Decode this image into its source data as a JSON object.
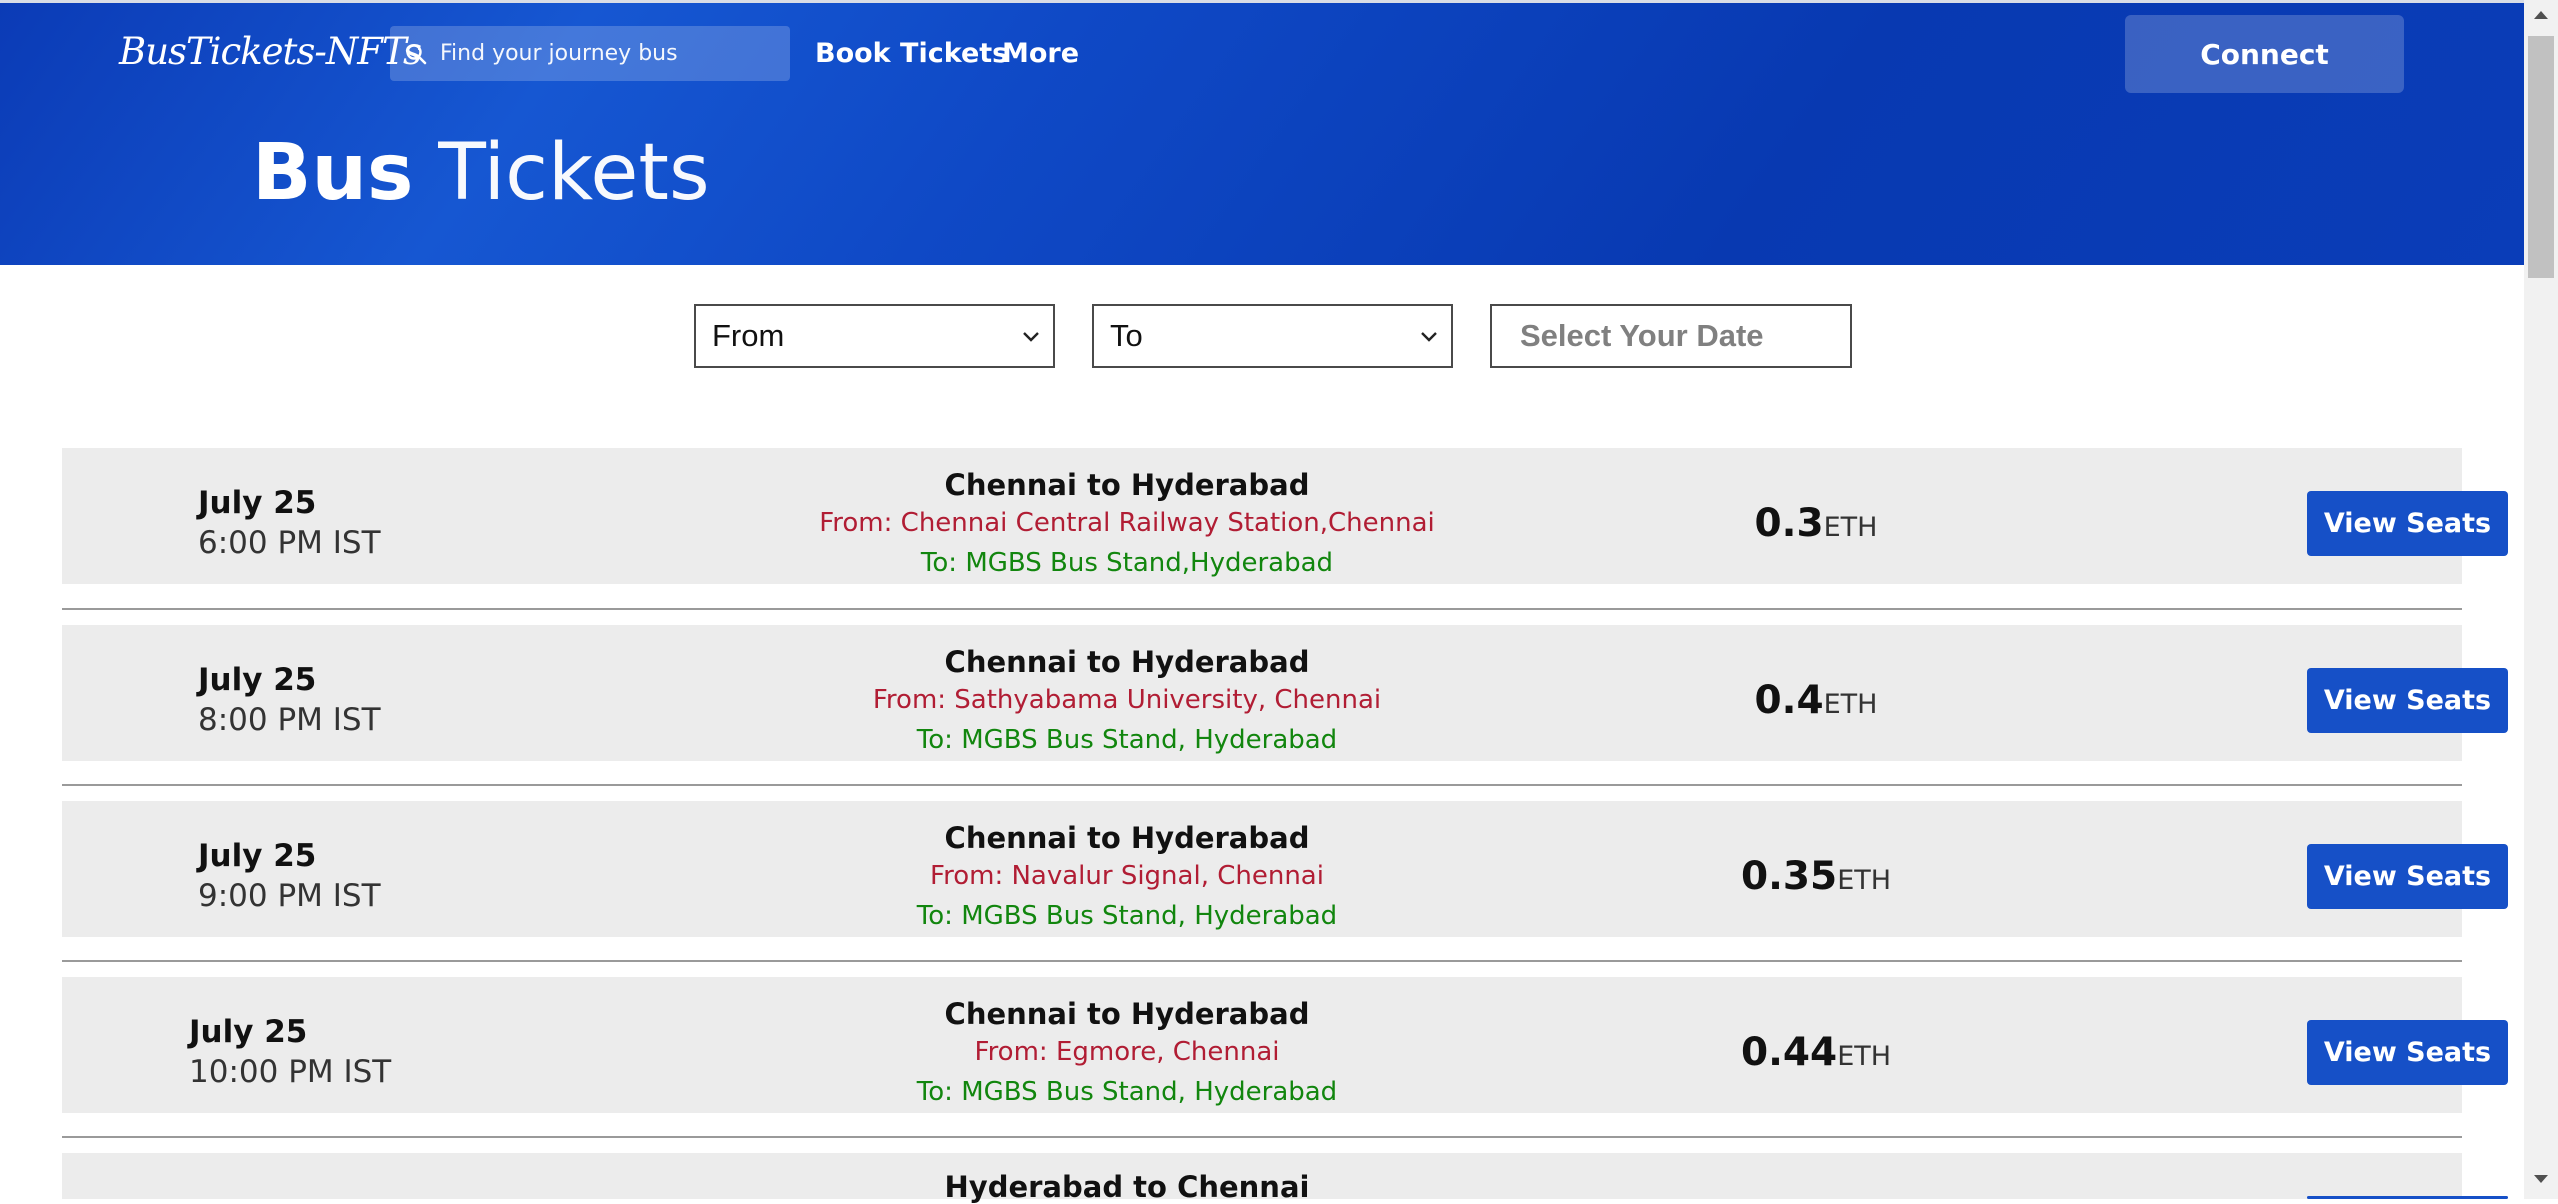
{
  "header": {
    "logo": "BusTickets-NFTs",
    "search_placeholder": "Find your journey bus",
    "nav": [
      "Book Tickets",
      "More"
    ],
    "connect_label": "Connect",
    "title_bold": "Bus",
    "title_rest": "Tickets"
  },
  "filters": {
    "from": "From",
    "to": "To",
    "date_placeholder": "Select Your Date"
  },
  "listings": [
    {
      "date": "July 25",
      "time": "6:00 PM IST",
      "route": "Chennai to Hyderabad",
      "from": "From: Chennai Central Railway Station,Chennai",
      "to": "To: MGBS Bus Stand,Hyderabad",
      "price": "0.3",
      "unit": "ETH",
      "button": "View Seats"
    },
    {
      "date": "July 25",
      "time": "8:00 PM IST",
      "route": "Chennai to Hyderabad",
      "from": "From: Sathyabama University, Chennai",
      "to": "To: MGBS Bus Stand, Hyderabad",
      "price": "0.4",
      "unit": "ETH",
      "button": "View Seats"
    },
    {
      "date": "July 25",
      "time": "9:00 PM IST",
      "route": "Chennai to Hyderabad",
      "from": "From: Navalur Signal, Chennai",
      "to": "To: MGBS Bus Stand, Hyderabad",
      "price": "0.35",
      "unit": "ETH",
      "button": "View Seats"
    },
    {
      "date": "July 25",
      "time": "10:00 PM IST",
      "route": "Chennai to Hyderabad",
      "from": "From: Egmore, Chennai",
      "to": "To: MGBS Bus Stand, Hyderabad",
      "price": "0.44",
      "unit": "ETH",
      "button": "View Seats"
    },
    {
      "route": "Hyderabad to Chennai"
    }
  ],
  "colors": {
    "brand_blue": "#0b3bb6",
    "button_blue": "#1650c7",
    "from_red": "#b11d34",
    "to_green": "#12860e"
  }
}
